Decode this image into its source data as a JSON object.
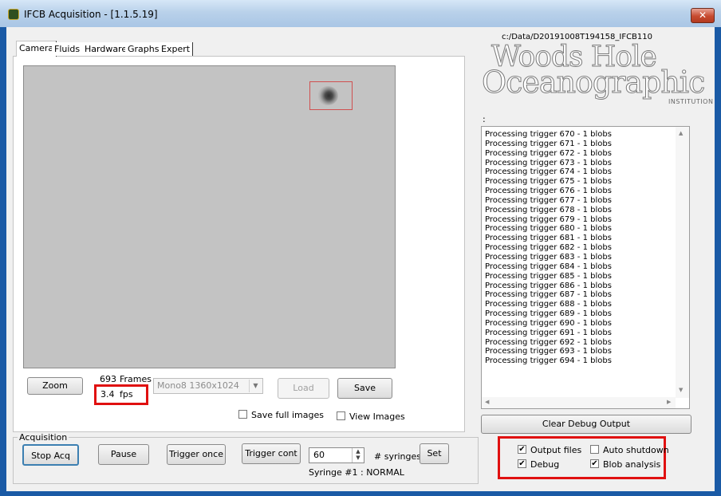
{
  "window": {
    "title": "IFCB Acquisition - [1.1.5.19]",
    "close_label": "✕"
  },
  "tabs": [
    {
      "label": "Camera"
    },
    {
      "label": "Fluids"
    },
    {
      "label": "Hardware"
    },
    {
      "label": "Graphs"
    },
    {
      "label": "Expert"
    }
  ],
  "camera": {
    "zoom_label": "Zoom",
    "frames_count": "693",
    "frames_label": "Frames",
    "fps_value": "3.4",
    "fps_label": "fps",
    "mode_select": "Mono8 1360x1024",
    "load_label": "Load",
    "save_label": "Save",
    "save_full_images_label": "Save full images",
    "view_images_label": "View Images"
  },
  "data_path": "c:/Data/D20191008T194158_IFCB110",
  "logo": {
    "line1": "Woods Hole",
    "line2": "Oceanographic",
    "line3": "INSTITUTION"
  },
  "status_colon": ":",
  "debug_log": [
    "Processing trigger 670 - 1 blobs",
    "Processing trigger 671 - 1 blobs",
    "Processing trigger 672 - 1 blobs",
    "Processing trigger 673 - 1 blobs",
    "Processing trigger 674 - 1 blobs",
    "Processing trigger 675 - 1 blobs",
    "Processing trigger 676 - 1 blobs",
    "Processing trigger 677 - 1 blobs",
    "Processing trigger 678 - 1 blobs",
    "Processing trigger 679 - 1 blobs",
    "Processing trigger 680 - 1 blobs",
    "Processing trigger 681 - 1 blobs",
    "Processing trigger 682 - 1 blobs",
    "Processing trigger 683 - 1 blobs",
    "Processing trigger 684 - 1 blobs",
    "Processing trigger 685 - 1 blobs",
    "Processing trigger 686 - 1 blobs",
    "Processing trigger 687 - 1 blobs",
    "Processing trigger 688 - 1 blobs",
    "Processing trigger 689 - 1 blobs",
    "Processing trigger 690 - 1 blobs",
    "Processing trigger 691 - 1 blobs",
    "Processing trigger 692 - 1 blobs",
    "Processing trigger 693 - 1 blobs",
    "Processing trigger 694 - 1 blobs"
  ],
  "clear_debug_label": "Clear Debug Output",
  "acquisition": {
    "group_label": "Acquisition",
    "stop_label": "Stop Acq",
    "pause_label": "Pause",
    "trigger_once_label": "Trigger once",
    "trigger_cont_label": "Trigger cont",
    "syringes_value": "60",
    "syringes_label": "# syringes",
    "set_label": "Set",
    "syringe_status": "Syringe #1 : NORMAL"
  },
  "options": {
    "output_files": {
      "label": "Output files",
      "checked": true
    },
    "auto_shutdown": {
      "label": "Auto shutdown",
      "checked": false
    },
    "debug": {
      "label": "Debug",
      "checked": true
    },
    "blob_analysis": {
      "label": "Blob analysis",
      "checked": true
    }
  },
  "colors": {
    "highlight": "#e01010",
    "title_bar": "#b9d1ea",
    "close_button": "#c74a2f"
  }
}
